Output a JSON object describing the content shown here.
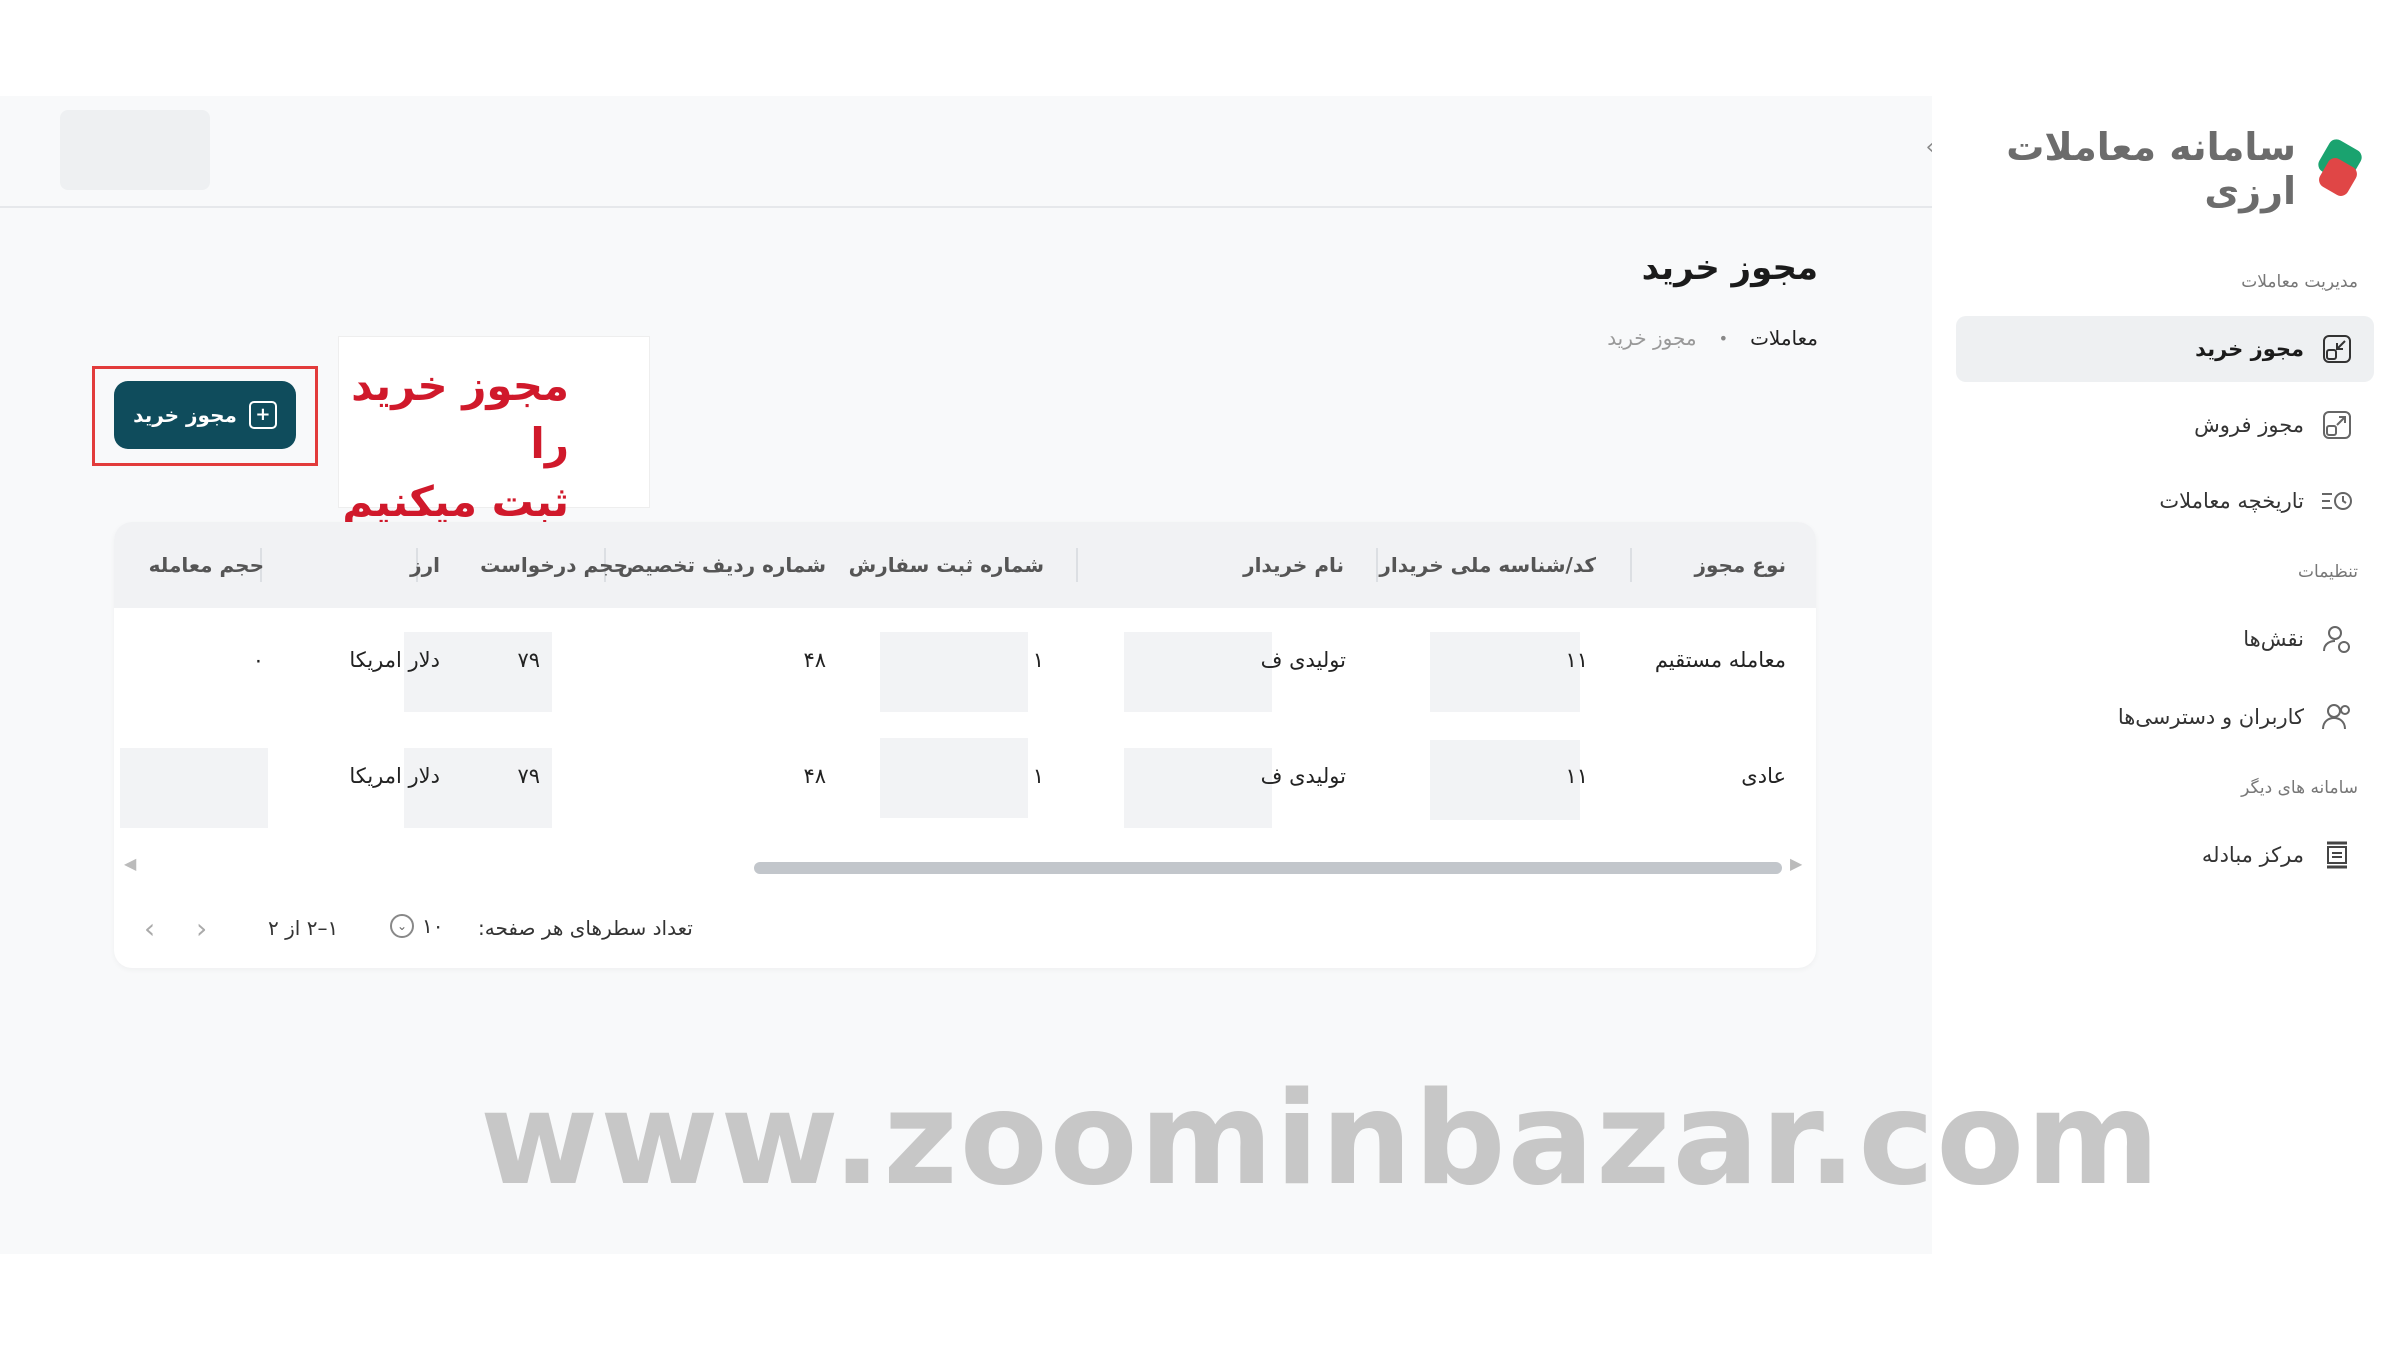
{
  "sidebar": {
    "logo_text": "سامانه معاملات ارزی",
    "section_trades": "مدیریت معاملات",
    "items_trades": [
      {
        "label": "مجوز خرید",
        "icon": "buy-permit-icon",
        "active": true
      },
      {
        "label": "مجوز فروش",
        "icon": "sell-permit-icon",
        "active": false
      },
      {
        "label": "تاریخچه معاملات",
        "icon": "history-icon",
        "active": false
      }
    ],
    "section_settings": "تنظیمات",
    "items_settings": [
      {
        "label": "نقش‌ها",
        "icon": "role-icon"
      },
      {
        "label": "کاربران و دسترسی‌ها",
        "icon": "users-icon"
      }
    ],
    "section_other": "سامانه های دیگر",
    "items_other": [
      {
        "label": "مرکز مبادله",
        "icon": "exchange-icon"
      }
    ]
  },
  "header": {
    "title": "مجوز خرید",
    "breadcrumb": [
      "معاملات",
      "مجوز خرید"
    ]
  },
  "annotation": {
    "text": "مجوز خرید را\nثبت میکنیم"
  },
  "actions": {
    "add_buy_permit_label": "مجوز خرید"
  },
  "table": {
    "columns": [
      "نوع مجوز",
      "کد/شناسه ملی خریدار",
      "نام خریدار",
      "شماره ثبت سفارش",
      "شماره ردیف تخصیص",
      "حجم درخواست",
      "ارز",
      "حجم معامله"
    ],
    "rows": [
      [
        "معامله مستقیم",
        "۱۱",
        "تولیدی ف",
        "۱",
        "۴۸",
        "۷۹",
        "دلار امریکا",
        "۰"
      ],
      [
        "عادی",
        "۱۱",
        "تولیدی ف",
        "۱",
        "۴۸",
        "۷۹",
        "دلار امریکا",
        ""
      ]
    ]
  },
  "pagination": {
    "rows_per_page_label": "تعداد سطرهای هر صفحه:",
    "rows_per_page_value": "۱۰",
    "range_text": "۱–۲ از ۲"
  },
  "watermark": "www.zoominbazar.com",
  "colors": {
    "primary": "#0f4c5c",
    "annotation_red": "#d0192b",
    "logo_green": "#1aa36f",
    "logo_red": "#e04646"
  }
}
